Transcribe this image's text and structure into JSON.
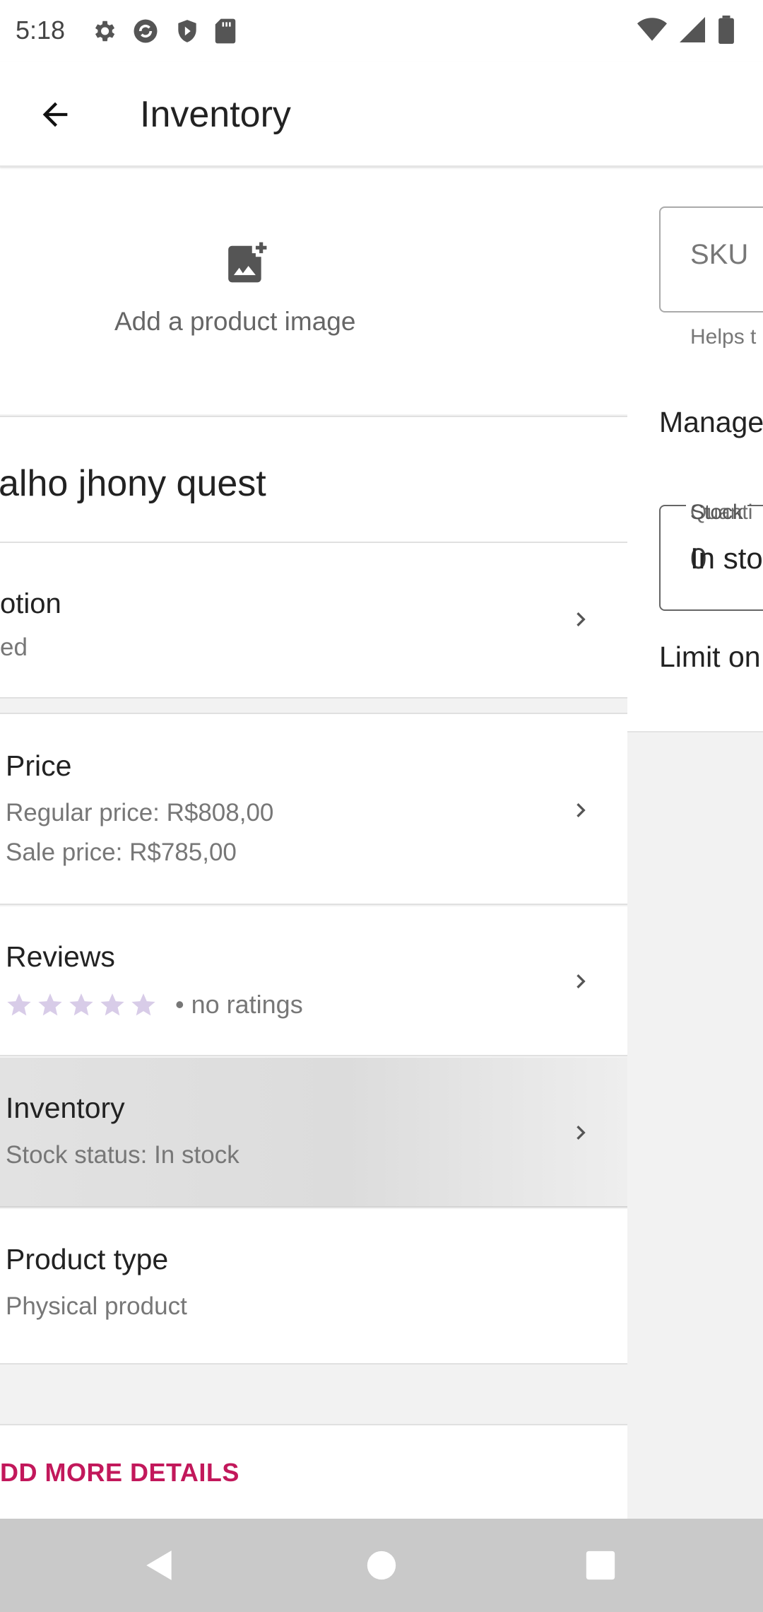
{
  "status_bar": {
    "time": "5:18",
    "left_icons": [
      "settings-icon",
      "sync-icon",
      "shield-icon",
      "sd-card-icon"
    ],
    "right_icons": [
      "wifi-icon",
      "signal-icon",
      "battery-icon"
    ]
  },
  "app_bar": {
    "title": "Inventory",
    "back_icon": "arrow-back-icon"
  },
  "product_pane": {
    "add_image_label": "Add a product image",
    "title": "alho jhony quest",
    "description": {
      "label": "otion",
      "sub": "ed"
    },
    "price": {
      "label": "Price",
      "regular": "Regular price: R$808,00",
      "sale": "Sale price: R$785,00"
    },
    "reviews": {
      "label": "Reviews",
      "rating_text": "• no ratings",
      "stars_filled": 0,
      "stars_total": 5,
      "star_color": "#d8cce8"
    },
    "inventory": {
      "label": "Inventory",
      "sub": "Stock status: In stock"
    },
    "product_type": {
      "label": "Product type",
      "sub": "Physical product"
    },
    "add_more": "DD MORE DETAILS",
    "accent_color": "#c2185b"
  },
  "inventory_pane": {
    "sku_placeholder": "SKU",
    "sku_helper": "Helps t",
    "manage_label": "Manage",
    "stock_legend_a": "Stock",
    "stock_legend_b": "Quanti",
    "stock_value_a": "In sto",
    "stock_value_b": "0",
    "limit_label": "Limit on"
  },
  "nav_bar": {
    "back": "nav-back-icon",
    "home": "nav-home-icon",
    "recents": "nav-recents-icon"
  }
}
